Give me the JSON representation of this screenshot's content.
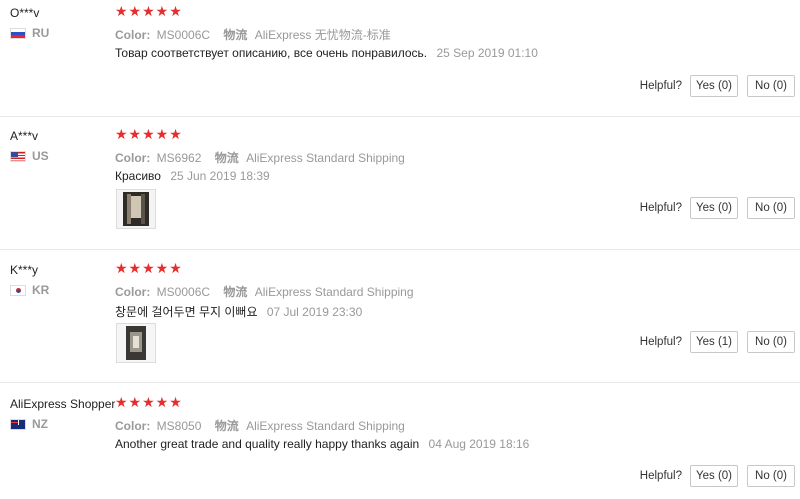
{
  "helpful_label": "Helpful?",
  "accent_color": "#e62e2e",
  "reviews": [
    {
      "user": "O***v",
      "country": "RU",
      "flag_icon": "flag-ru-icon",
      "stars": "★★★★★",
      "rating": 5,
      "color_label": "Color:",
      "color_value": "MS0006C",
      "shipping_label": "物流",
      "shipping_value": "AliExpress 无忧物流-标准",
      "text": "Товар соответствует описанию, все очень понравилось.",
      "date": "25 Sep 2019 01:10",
      "has_photo": false,
      "yes": "Yes (0)",
      "no": "No (0)"
    },
    {
      "user": "A***v",
      "country": "US",
      "flag_icon": "flag-us-icon",
      "stars": "★★★★★",
      "rating": 5,
      "color_label": "Color:",
      "color_value": "MS6962",
      "shipping_label": "物流",
      "shipping_value": "AliExpress Standard Shipping",
      "text": "Красиво",
      "date": "25 Jun 2019 18:39",
      "has_photo": true,
      "yes": "Yes (0)",
      "no": "No (0)"
    },
    {
      "user": "K***y",
      "country": "KR",
      "flag_icon": "flag-kr-icon",
      "stars": "★★★★★",
      "rating": 5,
      "color_label": "Color:",
      "color_value": "MS0006C",
      "shipping_label": "物流",
      "shipping_value": "AliExpress Standard Shipping",
      "text": "창문에 걸어두면 무지 이뻐요",
      "date": "07 Jul 2019 23:30",
      "has_photo": true,
      "yes": "Yes (1)",
      "no": "No (0)"
    },
    {
      "user": "AliExpress Shopper",
      "country": "NZ",
      "flag_icon": "flag-nz-icon",
      "stars": "★★★★★",
      "rating": 5,
      "color_label": "Color:",
      "color_value": "MS8050",
      "shipping_label": "物流",
      "shipping_value": "AliExpress Standard Shipping",
      "text": "Another great trade and quality really happy thanks again",
      "date": "04 Aug 2019 18:16",
      "has_photo": false,
      "yes": "Yes (0)",
      "no": "No (0)"
    }
  ]
}
